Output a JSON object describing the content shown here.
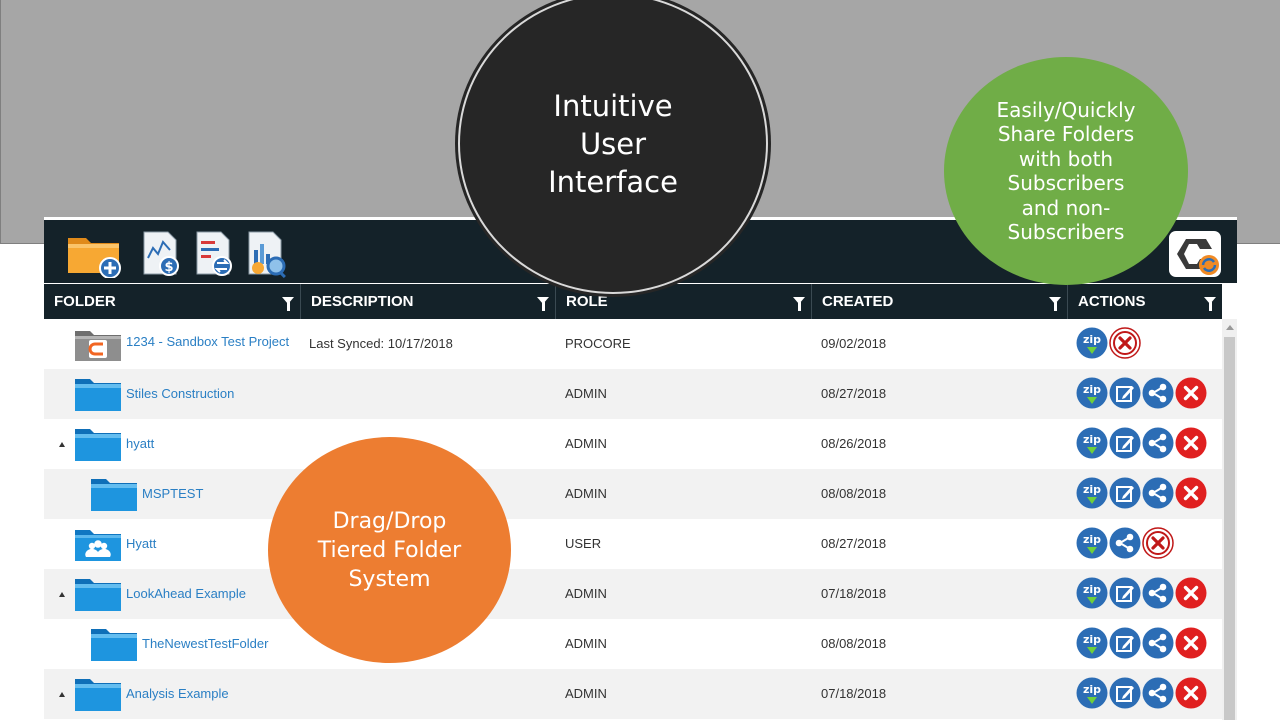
{
  "callouts": {
    "ui": "Intuitive\nUser\nInterface",
    "share": "Easily/Quickly\nShare Folders\nwith both\nSubscribers\nand non-\nSubscribers",
    "dragdrop": "Drag/Drop\nTiered Folder\nSystem"
  },
  "toolbar": {
    "icons": [
      "new-folder-icon",
      "budget-report-icon",
      "compare-report-icon",
      "analytics-report-icon"
    ],
    "logo": "sync-logo-icon"
  },
  "table": {
    "columns": [
      "FOLDER",
      "DESCRIPTION",
      "ROLE",
      "CREATED",
      "ACTIONS"
    ],
    "rows": [
      {
        "folder": "1234 - Sandbox Test Project",
        "description": "Last Synced: 10/17/2018",
        "role": "PROCORE",
        "created": "09/02/2018",
        "icon": "procore-folder-icon",
        "level": 0,
        "expand": false,
        "actions": [
          "zip",
          "delete-outline"
        ]
      },
      {
        "folder": "Stiles Construction",
        "description": "",
        "role": "ADMIN",
        "created": "08/27/2018",
        "icon": "blue-folder-icon",
        "level": 0,
        "expand": false,
        "actions": [
          "zip",
          "edit",
          "share",
          "delete"
        ]
      },
      {
        "folder": "hyatt",
        "description": "",
        "role": "ADMIN",
        "created": "08/26/2018",
        "icon": "blue-folder-icon",
        "level": 0,
        "expand": true,
        "actions": [
          "zip",
          "edit",
          "share",
          "delete"
        ]
      },
      {
        "folder": "MSPTEST",
        "description": "",
        "role": "ADMIN",
        "created": "08/08/2018",
        "icon": "blue-folder-icon",
        "level": 1,
        "expand": false,
        "actions": [
          "zip",
          "edit",
          "share",
          "delete"
        ]
      },
      {
        "folder": "Hyatt",
        "description": "",
        "role": "USER",
        "created": "08/27/2018",
        "icon": "shared-folder-icon",
        "level": 0,
        "expand": false,
        "actions": [
          "zip",
          "share",
          "delete-outline"
        ]
      },
      {
        "folder": "LookAhead Example",
        "description": "",
        "role": "ADMIN",
        "created": "07/18/2018",
        "icon": "blue-folder-icon",
        "level": 0,
        "expand": true,
        "actions": [
          "zip",
          "edit",
          "share",
          "delete"
        ]
      },
      {
        "folder": "TheNewestTestFolder",
        "description": "",
        "role": "ADMIN",
        "created": "08/08/2018",
        "icon": "blue-folder-icon",
        "level": 1,
        "expand": false,
        "actions": [
          "zip",
          "edit",
          "share",
          "delete"
        ]
      },
      {
        "folder": "Analysis Example",
        "description": "",
        "role": "ADMIN",
        "created": "07/18/2018",
        "icon": "blue-folder-icon",
        "level": 0,
        "expand": true,
        "actions": [
          "zip",
          "edit",
          "share",
          "delete"
        ]
      }
    ]
  },
  "colors": {
    "band": "#a6a6a6",
    "toolbar": "#142229",
    "link": "#2a7fc4",
    "ui_bubble": "#262626",
    "share_bubble": "#70ad47",
    "drag_bubble": "#ed7d31",
    "action_blue": "#2c6db5",
    "delete_red": "#e02020"
  }
}
